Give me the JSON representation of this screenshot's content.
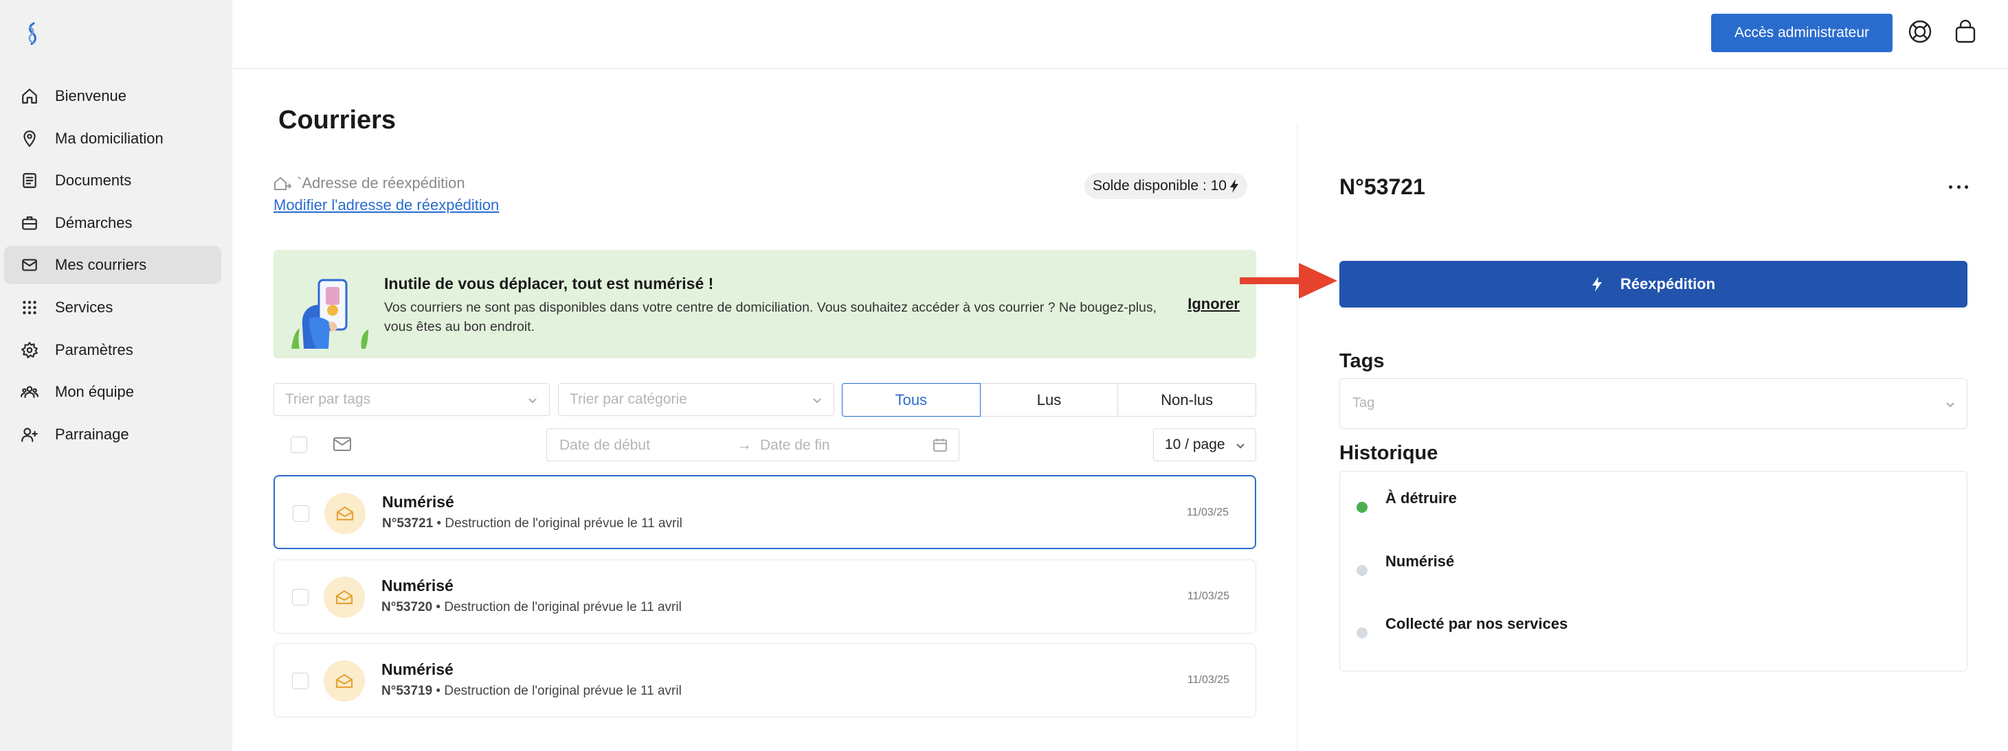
{
  "sidebar": {
    "items": [
      {
        "label": "Bienvenue",
        "icon": "home-icon"
      },
      {
        "label": "Ma domiciliation",
        "icon": "location-pin-icon"
      },
      {
        "label": "Documents",
        "icon": "document-icon"
      },
      {
        "label": "Démarches",
        "icon": "briefcase-icon"
      },
      {
        "label": "Mes courriers",
        "icon": "mail-icon"
      },
      {
        "label": "Services",
        "icon": "grid-icon"
      },
      {
        "label": "Paramètres",
        "icon": "gear-icon"
      },
      {
        "label": "Mon équipe",
        "icon": "team-icon"
      },
      {
        "label": "Parrainage",
        "icon": "add-user-icon"
      }
    ],
    "active_index": 4
  },
  "header": {
    "admin_label": "Accès administrateur"
  },
  "main": {
    "title": "Courriers",
    "address_label": "`Adresse de réexpédition",
    "address_link": "Modifier l'adresse de réexpédition",
    "solde": "Solde disponible : 10",
    "banner": {
      "title": "Inutile de vous déplacer, tout est numérisé !",
      "text": "Vos courriers ne sont pas disponibles dans votre centre de domiciliation. Vous souhaitez accéder à vos courrier ? Ne bougez-plus, vous êtes au bon endroit.",
      "ignore": "Ignorer"
    },
    "filters": {
      "tags_placeholder": "Trier par tags",
      "category_placeholder": "Trier par catégorie",
      "segments": [
        "Tous",
        "Lus",
        "Non-lus"
      ],
      "date_start": "Date de début",
      "date_end": "Date de fin",
      "per_page": "10 / page"
    },
    "mails": [
      {
        "status": "Numérisé",
        "number": "N°53721",
        "detail": " • Destruction de l'original prévue le 11 avril",
        "date": "11/03/25"
      },
      {
        "status": "Numérisé",
        "number": "N°53720",
        "detail": " • Destruction de l'original prévue le 11 avril",
        "date": "11/03/25"
      },
      {
        "status": "Numérisé",
        "number": "N°53719",
        "detail": " • Destruction de l'original prévue le 11 avril",
        "date": "11/03/25"
      }
    ]
  },
  "detail": {
    "title": "N°53721",
    "reexp_label": "Réexpédition",
    "tags_heading": "Tags",
    "tag_placeholder": "Tag",
    "history_heading": "Historique",
    "history": [
      {
        "label": "À détruire",
        "color": "#4cb050"
      },
      {
        "label": "Numérisé",
        "color": "#d6dbe2"
      },
      {
        "label": "Collecté par nos services",
        "color": "#d6dbe2"
      }
    ]
  },
  "colors": {
    "accent": "#2a6ccd",
    "reexp": "#2254ad",
    "banner_bg": "#e3f2dc",
    "arrow": "#e5432d"
  }
}
